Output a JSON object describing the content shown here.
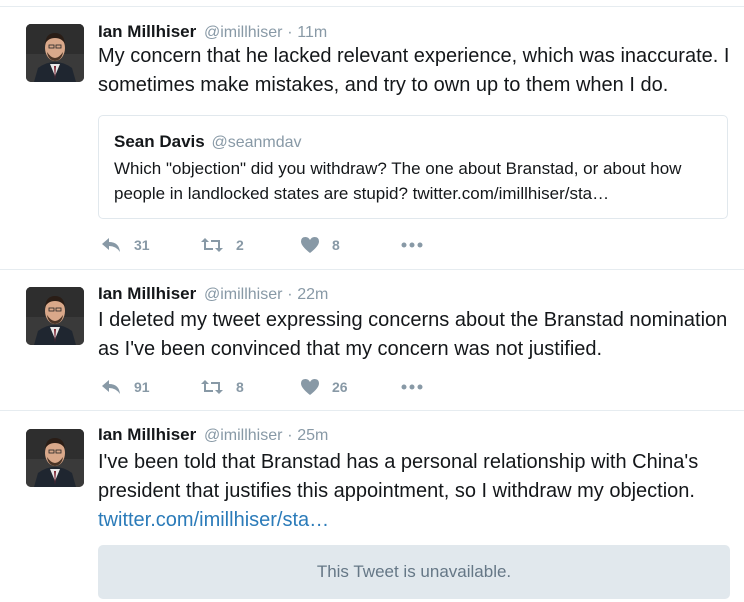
{
  "tweets": [
    {
      "author": {
        "name": "Ian Millhiser",
        "handle": "@imillhiser"
      },
      "separator": "·",
      "time": "11m",
      "text": "My concern that he lacked relevant experience, which was inaccurate. I sometimes make mistakes, and try to own up to them when I do.",
      "quoted_tweet": {
        "name": "Sean Davis",
        "handle": "@seanmdav",
        "text": "Which \"objection\" did you withdraw? The one about Branstad, or about how people in landlocked states are stupid? twitter.com/imillhiser/sta…"
      },
      "actions": {
        "reply_count": "31",
        "retweet_count": "2",
        "like_count": "8"
      }
    },
    {
      "author": {
        "name": "Ian Millhiser",
        "handle": "@imillhiser"
      },
      "separator": "·",
      "time": "22m",
      "text": "I deleted my tweet expressing concerns about the Branstad nomination as I've been convinced that my concern was not justified.",
      "actions": {
        "reply_count": "91",
        "retweet_count": "8",
        "like_count": "26"
      }
    },
    {
      "author": {
        "name": "Ian Millhiser",
        "handle": "@imillhiser"
      },
      "separator": "·",
      "time": "25m",
      "text": "I've been told that Branstad has a personal relationship with China's president that justifies this appointment, so I withdraw my objection.",
      "link": "twitter.com/imillhiser/sta…",
      "unavailable_notice": "This Tweet is unavailable."
    }
  ],
  "icons": {
    "reply": "reply-icon",
    "retweet": "retweet-icon",
    "like": "heart-icon",
    "more": "more-dots-icon"
  },
  "colors": {
    "text": "#14171a",
    "muted": "#8899a6",
    "link": "#2b7bb9",
    "border": "#e6ecf0",
    "unavailable_bg": "#e1e8ed"
  }
}
